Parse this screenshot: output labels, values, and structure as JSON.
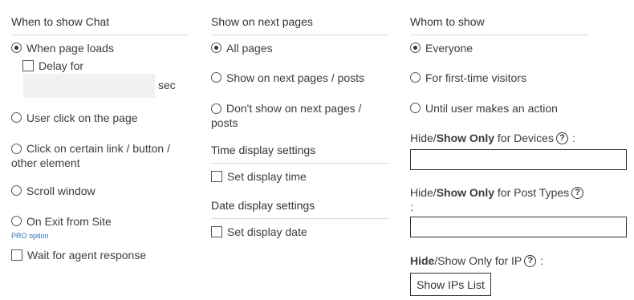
{
  "col1": {
    "heading": "When to show Chat",
    "opt_page_loads": "When page loads",
    "delay_label": "Delay for",
    "delay_value": "",
    "sec": "sec",
    "opt_user_click": "User click on the page",
    "opt_click_link": "Click on certain link / button / other element",
    "opt_scroll": "Scroll window",
    "opt_exit": "On Exit from Site",
    "pro_option": "PRO option",
    "wait_agent": "Wait for agent response"
  },
  "col2": {
    "heading": "Show on next pages",
    "opt_all_pages": "All pages",
    "opt_next_pages": "Show on next pages / posts",
    "opt_dont_show": "Don't show on next pages / posts",
    "time_heading": "Time display settings",
    "set_time": "Set display time",
    "date_heading": "Date display settings",
    "set_date": "Set display date"
  },
  "col3": {
    "heading": "Whom to show",
    "opt_everyone": "Everyone",
    "opt_first_time": "For first-time visitors",
    "opt_until_action": "Until user makes an action",
    "devices_hide": "Hide/",
    "devices_show": "Show Only",
    "devices_rest": " for Devices",
    "devices_colon": ":",
    "devices_value": "",
    "post_hide": "Hide/",
    "post_show": "Show Only",
    "post_rest": " for Post Types",
    "post_colon": ":",
    "post_value": "",
    "ip_hide": "Hide",
    "ip_rest": "/Show Only for IP",
    "ip_colon": ":",
    "show_ips_button": "Show IPs List",
    "help_glyph": "?"
  }
}
